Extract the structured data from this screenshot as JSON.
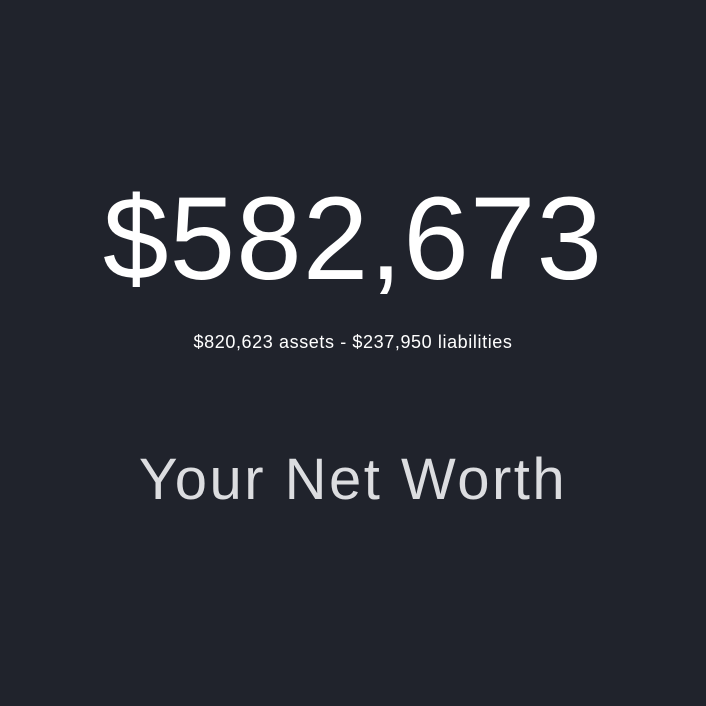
{
  "net_worth": {
    "value": "$582,673",
    "breakdown": "$820,623 assets - $237,950 liabilities",
    "caption": "Your Net Worth"
  },
  "colors": {
    "background": "#20232c",
    "primary_text": "#ffffff",
    "caption_text": "#dcdde0"
  }
}
